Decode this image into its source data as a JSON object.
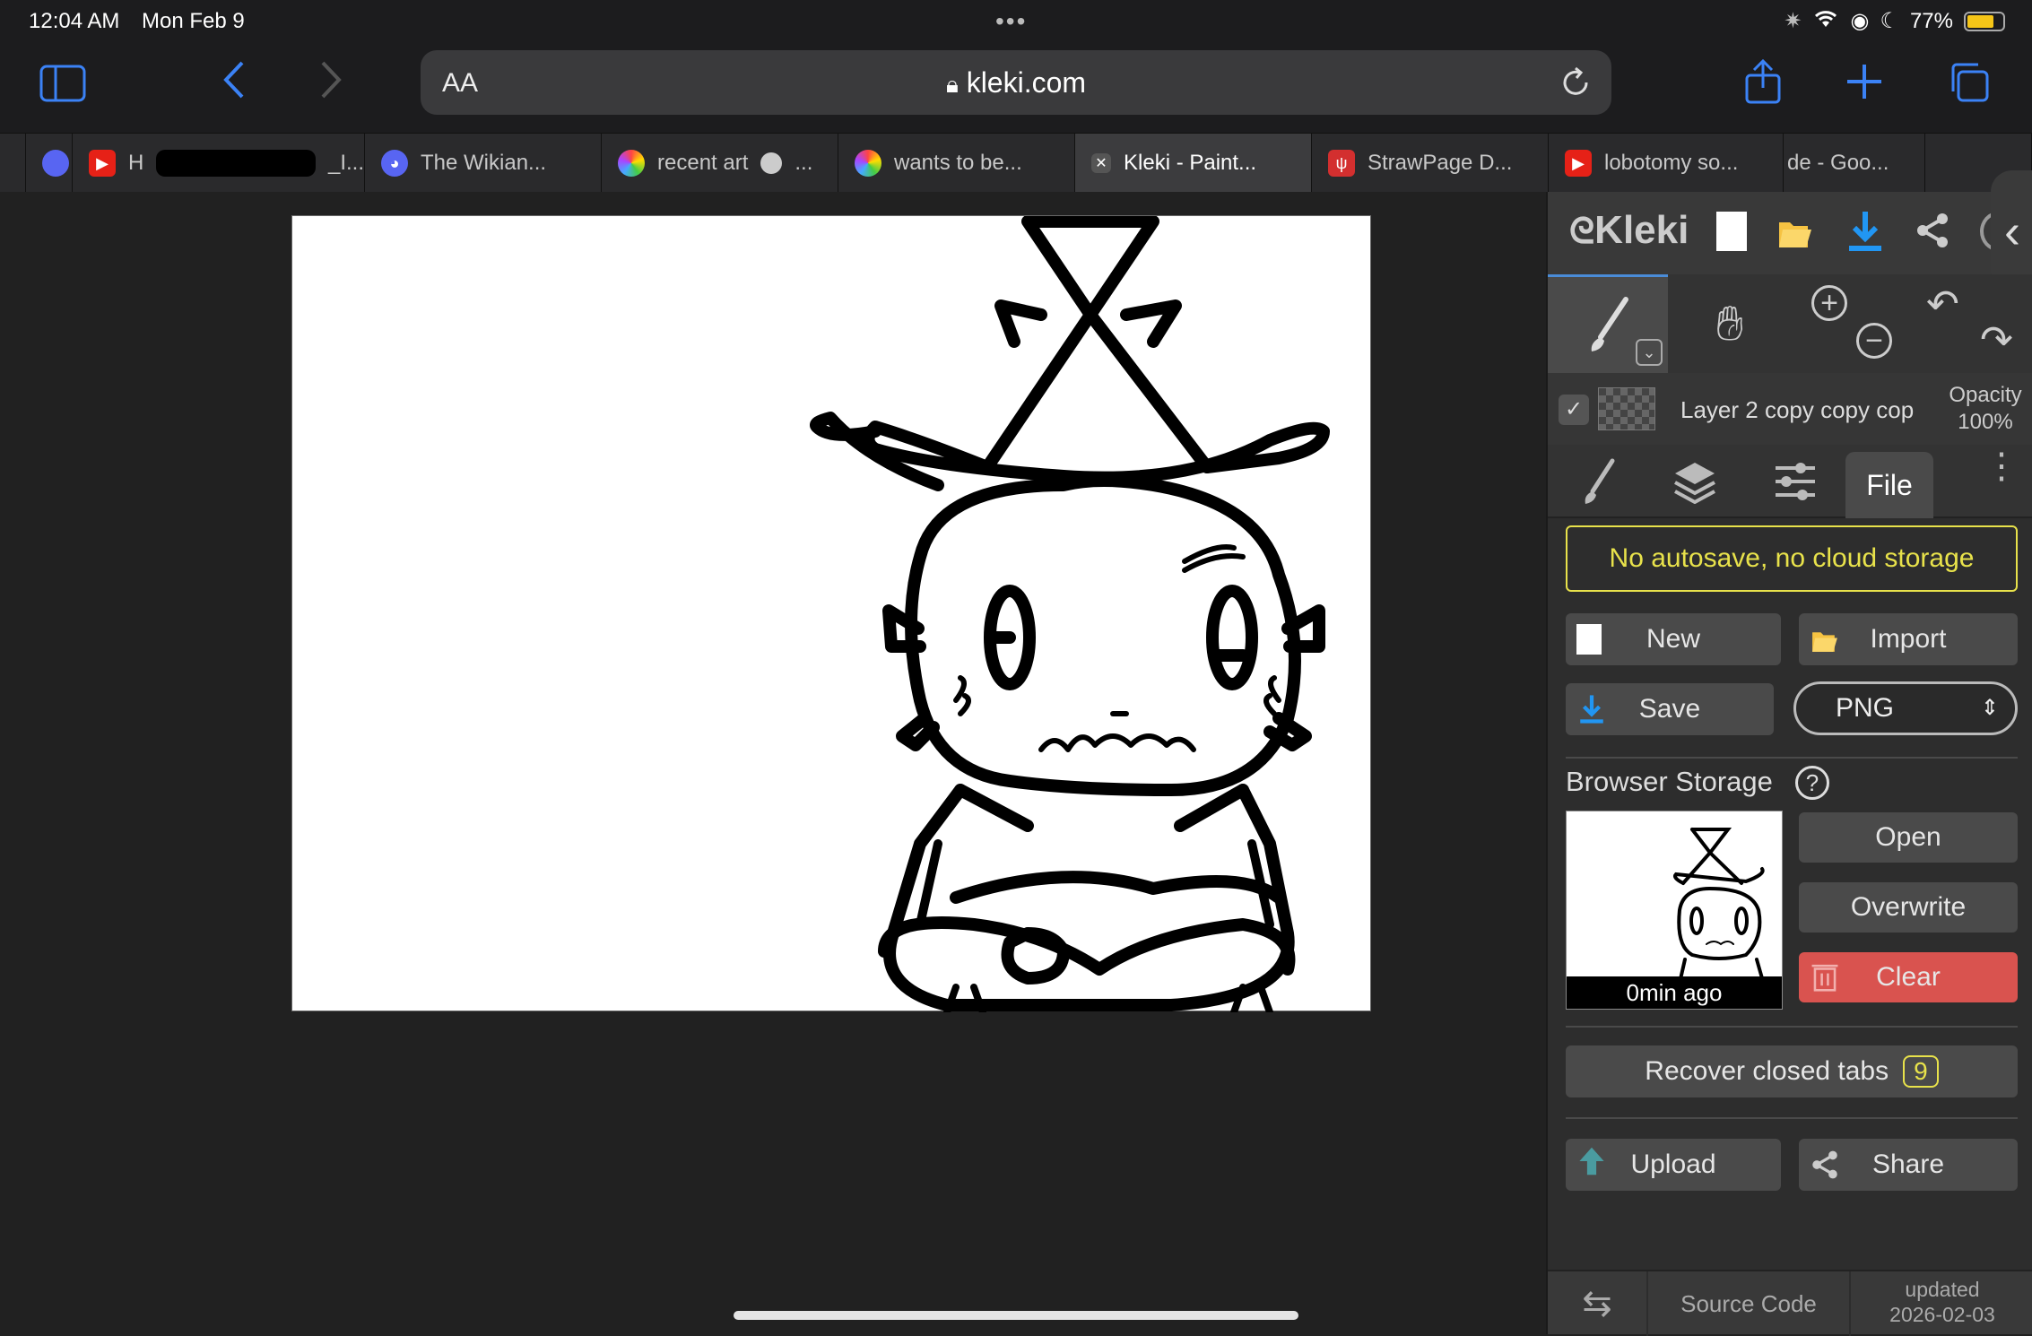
{
  "status": {
    "time": "12:04 AM",
    "date": "Mon Feb 9",
    "battery": "77%",
    "battery_level": 0.77,
    "battery_color": "#f5c518"
  },
  "browser": {
    "url_aa": "AA",
    "domain": "kleki.com",
    "accent": "#3b82f6",
    "tabs": [
      {
        "label": "H",
        "icon": "youtube-icon",
        "color": "#e62117"
      },
      {
        "label": "_I...",
        "icon": "redacted"
      },
      {
        "label": "The Wikian...",
        "icon": "discord-icon",
        "color": "#5865f2"
      },
      {
        "label": "recent art",
        "icon": "flower-icon",
        "color": "#f0a"
      },
      {
        "label": "wants to be...",
        "icon": "flower-icon",
        "color": "#f0a"
      },
      {
        "label": "Kleki - Paint...",
        "icon": "close-icon",
        "active": true
      },
      {
        "label": "StrawPage D...",
        "icon": "strawpage-icon",
        "color": "#d32f2f"
      },
      {
        "label": "lobotomy so...",
        "icon": "youtube-icon",
        "color": "#e62117"
      },
      {
        "label": "de - Goo...",
        "icon": "google-icon"
      }
    ]
  },
  "panel": {
    "logo": "Kleki",
    "layer_name": "Layer 2 copy copy cop",
    "opacity_label": "Opacity",
    "opacity_value": "100%",
    "tab_file": "File",
    "warning": "No autosave, no cloud storage",
    "warning_color": "#e8e24b",
    "buttons": {
      "new": "New",
      "import": "Import",
      "save": "Save",
      "format": "PNG",
      "open": "Open",
      "overwrite": "Overwrite",
      "clear": "Clear",
      "recover": "Recover closed tabs",
      "recover_count": "9",
      "upload": "Upload",
      "share": "Share"
    },
    "clear_color": "#d9534f",
    "browser_storage": "Browser Storage",
    "help": "?",
    "thumb_label": "0min ago",
    "footer": {
      "source": "Source Code",
      "updated_label": "updated",
      "updated_date": "2026-02-03"
    }
  }
}
